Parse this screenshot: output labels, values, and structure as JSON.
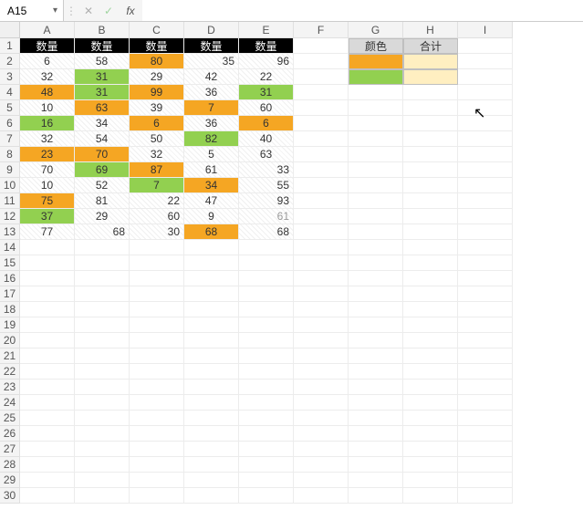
{
  "nameBox": {
    "value": "A15"
  },
  "formulaBar": {
    "fx": "fx",
    "value": ""
  },
  "columns": [
    "A",
    "B",
    "C",
    "D",
    "E",
    "F",
    "G",
    "H",
    "I"
  ],
  "rows": [
    "1",
    "2",
    "3",
    "4",
    "5",
    "6",
    "7",
    "8",
    "9",
    "10",
    "11",
    "12",
    "13",
    "14",
    "15",
    "16",
    "17",
    "18",
    "19",
    "20",
    "21",
    "22",
    "23",
    "24",
    "25",
    "26",
    "27",
    "28",
    "29",
    "30"
  ],
  "headers": {
    "a": "数量",
    "b": "数量",
    "c": "数量",
    "d": "数量",
    "e": "数量"
  },
  "summary": {
    "colorLabel": "颜色",
    "sumLabel": "合计"
  },
  "chart_data": {
    "type": "table",
    "columns": [
      "数量",
      "数量",
      "数量",
      "数量",
      "数量"
    ],
    "rows": [
      [
        6,
        58,
        80,
        35,
        96
      ],
      [
        32,
        31,
        29,
        42,
        22
      ],
      [
        48,
        31,
        99,
        36,
        31
      ],
      [
        10,
        63,
        39,
        7,
        60
      ],
      [
        16,
        34,
        6,
        36,
        6
      ],
      [
        32,
        54,
        50,
        82,
        40
      ],
      [
        23,
        70,
        32,
        5,
        63
      ],
      [
        70,
        69,
        87,
        61,
        33
      ],
      [
        10,
        52,
        7,
        34,
        55
      ],
      [
        75,
        81,
        22,
        47,
        93
      ],
      [
        37,
        29,
        60,
        9,
        61
      ],
      [
        77,
        68,
        30,
        68,
        68
      ]
    ],
    "fills": {
      "orange": [
        [
          1,
          "C"
        ],
        [
          3,
          "A"
        ],
        [
          3,
          "C"
        ],
        [
          4,
          "B"
        ],
        [
          4,
          "D"
        ],
        [
          5,
          "C"
        ],
        [
          5,
          "E"
        ],
        [
          7,
          "A"
        ],
        [
          7,
          "B"
        ],
        [
          8,
          "C"
        ],
        [
          9,
          "D"
        ],
        [
          10,
          "A"
        ],
        [
          12,
          "D"
        ]
      ],
      "green": [
        [
          2,
          "B"
        ],
        [
          3,
          "B"
        ],
        [
          3,
          "E"
        ],
        [
          5,
          "A"
        ],
        [
          6,
          "D"
        ],
        [
          8,
          "B"
        ],
        [
          9,
          "C"
        ],
        [
          11,
          "A"
        ]
      ]
    },
    "summary": {
      "headers": [
        "颜色",
        "合计"
      ],
      "rows": [
        [
          "orange",
          ""
        ],
        [
          "green",
          ""
        ]
      ]
    }
  },
  "t": {
    "r2": {
      "a": "6",
      "b": "58",
      "c": "80",
      "d": "35",
      "e": "96"
    },
    "r3": {
      "a": "32",
      "b": "31",
      "c": "29",
      "d": "42",
      "e": "22"
    },
    "r4": {
      "a": "48",
      "b": "31",
      "c": "99",
      "d": "36",
      "e": "31"
    },
    "r5": {
      "a": "10",
      "b": "63",
      "c": "39",
      "d": "7",
      "e": "60"
    },
    "r6": {
      "a": "16",
      "b": "34",
      "c": "6",
      "d": "36",
      "e": "6"
    },
    "r7": {
      "a": "32",
      "b": "54",
      "c": "50",
      "d": "82",
      "e": "40"
    },
    "r8": {
      "a": "23",
      "b": "70",
      "c": "32",
      "d": "5",
      "e": "63"
    },
    "r9": {
      "a": "70",
      "b": "69",
      "c": "87",
      "d": "61",
      "e": "33"
    },
    "r10": {
      "a": "10",
      "b": "52",
      "c": "7",
      "d": "34",
      "e": "55"
    },
    "r11": {
      "a": "75",
      "b": "81",
      "c": "22",
      "d": "47",
      "e": "93"
    },
    "r12": {
      "a": "37",
      "b": "29",
      "c": "60",
      "d": "9",
      "e": "61"
    },
    "r13": {
      "a": "77",
      "b": "68",
      "c": "30",
      "d": "68",
      "e": "68"
    }
  }
}
